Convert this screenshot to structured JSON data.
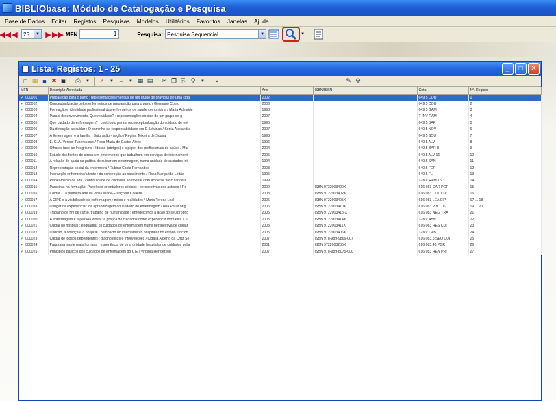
{
  "app": {
    "title": "BIBLIObase: Módulo de Catalogação e Pesquisa"
  },
  "menu": [
    "Base de Dados",
    "Editar",
    "Registos",
    "Pesquisas",
    "Modelos",
    "Utilitários",
    "Favoritos",
    "Janelas",
    "Ajuda"
  ],
  "toolbar": {
    "zoom": "25",
    "mfn_label": "MFN",
    "mfn_value": "1",
    "search_label": "Pesquisa:",
    "search_value": "Pesquisa Sequencial"
  },
  "child": {
    "title": "Lista: Registos: 1 - 25"
  },
  "columns": [
    "MFN",
    "Descrição Abreviada",
    "Ano",
    "ISBN/ISSN",
    "Cota",
    "Nº. Registo"
  ],
  "rows": [
    {
      "mfn": "000001",
      "desc": "Preparação para o parto : representações mentais de um grupo de grávidas de uma cida",
      "ano": "2002",
      "isbn": "",
      "cota": "649.5 COU",
      "reg": "1"
    },
    {
      "mfn": "000002",
      "desc": "Conceptualização pelos enfermeiros de preparação para o parto / Germano Couto",
      "ano": "2006",
      "isbn": "",
      "cota": "649.5 COU",
      "reg": "2"
    },
    {
      "mfn": "000003",
      "desc": "Formação e identidade profissional dos enfermeiros de saúde comunitária / Maria Adelaide",
      "ano": "1993",
      "isbn": "",
      "cota": "649.5 GAM",
      "reg": "3"
    },
    {
      "mfn": "000004",
      "desc": "Para o desenvolvimento, Que realidade? : representações sociais de um grupo de g",
      "ano": "2007",
      "isbn": "",
      "cota": "T-INV RAM",
      "reg": "4"
    },
    {
      "mfn": "000005",
      "desc": "Que cuidado de enfermagem? : contributo para a reconceptualização do cuidado de enf",
      "ano": "1996",
      "isbn": "",
      "cota": "649.5 BAR",
      "reg": "5"
    },
    {
      "mfn": "000006",
      "desc": "Da detecção ao cuidar : O caminho da responsabilidade em E. Lévinas / Sónia Alexandra",
      "ano": "2007",
      "isbn": "",
      "cota": "649.5 NOV",
      "reg": "6"
    },
    {
      "mfn": "000007",
      "desc": "A Enfermagem e a família : Saturação - acção / Regina Teixeira de Sousa",
      "ano": "1993",
      "isbn": "",
      "cota": "649.5 SOU",
      "reg": "7"
    },
    {
      "mfn": "000008",
      "desc": "E. C. A. Versus Tuberculose / Rosa Maria de Castro Alves",
      "ano": "1996",
      "isbn": "",
      "cota": "649.5 ALV",
      "reg": "8"
    },
    {
      "mfn": "000009",
      "desc": "Olhares face ao Integrismo : Idosos (abrigos) e o papel dos profissionais de saúde / Mar",
      "ano": "2004",
      "isbn": "",
      "cota": "649.5 BAR II",
      "reg": "9"
    },
    {
      "mfn": "000010",
      "desc": "Estudo dos fontes de stress em enfermeiros que trabalham em serviços de internament",
      "ano": "2006",
      "isbn": "",
      "cota": "649.5 ALV 16",
      "reg": "10"
    },
    {
      "mfn": "000011",
      "desc": "A relação de ajuda no prática do cuidar em enfermagem, numa unidade de cuidados int",
      "ano": "1994",
      "isbn": "",
      "cota": "649.5 SAN",
      "reg": "11"
    },
    {
      "mfn": "000012",
      "desc": "Representação social da enfermeira / Rubina Costa Fernandes",
      "ano": "2003",
      "isbn": "",
      "cota": "649.5 FER",
      "reg": "12"
    },
    {
      "mfn": "000013",
      "desc": "Interacção enfermeira/ utente : da concepção ao nascimento / Rosa Margarida Leitão",
      "ano": "1995",
      "isbn": "",
      "cota": "649.5 FL",
      "reg": "13"
    },
    {
      "mfn": "000014",
      "desc": "Planeamento de alta / continuidade de cuidados ao doente com acidente vascular cere",
      "ano": "1999",
      "isbn": "",
      "cota": "T-INV RAM 16",
      "reg": "14"
    },
    {
      "mfn": "000015",
      "desc": "Parceiras na formação: Papel dos orientadores clínicos : perspectivas dos actores / Ro",
      "ano": "2002",
      "isbn": "ISBN 9722003400X",
      "cota": "616.083 CAR PGR",
      "reg": "15"
    },
    {
      "mfn": "000016",
      "desc": "Cuidar ... a primeira arte da vida / Marie-Françoise Collière",
      "ano": "2003",
      "isbn": "ISBN 9722003402X",
      "cota": "616.083 COL CUI",
      "reg": "16"
    },
    {
      "mfn": "000017",
      "desc": "A CIPE e a visibilidade da enfermagem : mitos e realidades / Maria Teresa Leal",
      "ano": "2006",
      "isbn": "ISBN 9722003405X",
      "cota": "616.083 LEA CIP",
      "reg": "17 ... 18"
    },
    {
      "mfn": "000018",
      "desc": "O lugar da experiência : da aprendizagem do cuidado de enfermagem / Ana Paula Mig",
      "ano": "2006",
      "isbn": "ISBN 9722003410X",
      "cota": "616.083 PIN LUG",
      "reg": "19 ... 20"
    },
    {
      "mfn": "000019",
      "desc": "Trabalho de fim de curso, trabalho de humanidade : enreqeicimos a ação do seu próprio",
      "ano": "2005",
      "isbn": "ISBN 9722003413-X",
      "cota": "616.083 NEG TRA",
      "reg": "21"
    },
    {
      "mfn": "000020",
      "desc": "A enfermagem e a pessoa idosa : a prática de cuidados como experiência formativa / Ju",
      "ano": "2005",
      "isbn": "ISBN 9722003414X",
      "cota": "T-INV ABN",
      "reg": "22"
    },
    {
      "mfn": "000021",
      "desc": "Cuidar no hospital : enquadrar os cuidados de enfermagem numa perspectiva de cuidar",
      "ano": "2003",
      "isbn": "ISBN 9722003411X",
      "cota": "616.083 HES CUI",
      "reg": "23"
    },
    {
      "mfn": "000022",
      "desc": "O idoso, a doença e o hospital : o impacto do internamento hospitalar no estado funcion",
      "ano": "2005",
      "isbn": "ISBN 9722003406X",
      "cota": "T-INV CAB",
      "reg": "24"
    },
    {
      "mfn": "000023",
      "desc": "Cuidar de idosos dependentes : diagnósticos e intervenções / Cidalia Alberto da Cruz Se",
      "ano": "2007",
      "isbn": "ISBN 978-989-9866-007",
      "cota": "616.083.5 SEQ CUI",
      "reg": "25"
    },
    {
      "mfn": "000024",
      "desc": "Para uma morte mais humana : experiência de uma unidade hospitalar de cuidados palia",
      "ano": "2001",
      "isbn": "ISBN 9722003285X",
      "cota": "616.083.48 PGR",
      "reg": "26"
    },
    {
      "mfn": "000025",
      "desc": "Princípios básicos dos cuidados de enfermagem do CIE / Virginia Henderson",
      "ano": "2007",
      "isbn": "ISBN 978-989-8075-000",
      "cota": "616.083 HEN PRI",
      "reg": "27"
    }
  ]
}
